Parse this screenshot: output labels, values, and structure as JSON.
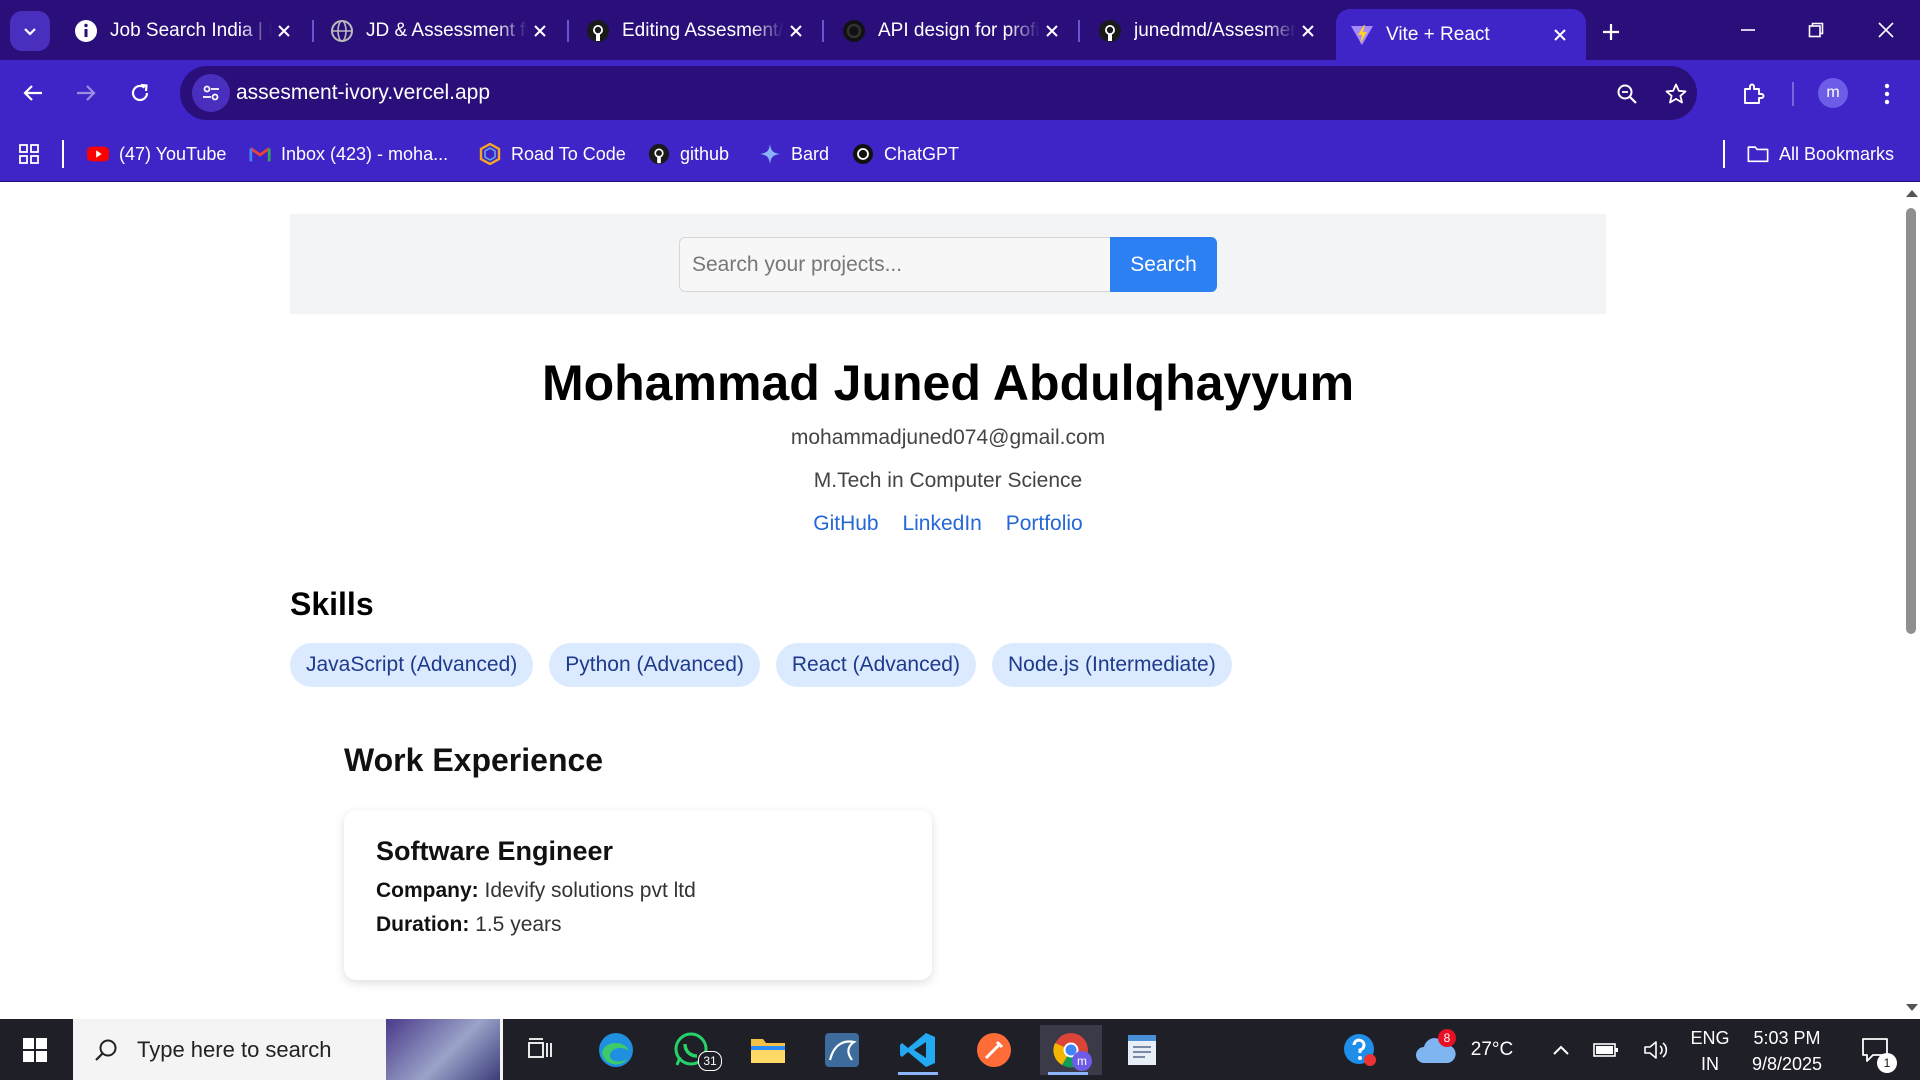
{
  "browser": {
    "tabs": [
      {
        "title": "Job Search India | Indeed",
        "icon": "info-icon"
      },
      {
        "title": "JD & Assessment for",
        "icon": "globe-icon"
      },
      {
        "title": "Editing Assesment/README",
        "icon": "github-icon"
      },
      {
        "title": "API design for profile",
        "icon": "openai-icon"
      },
      {
        "title": "junedmd/Assesment",
        "icon": "github-icon"
      },
      {
        "title": "Vite + React",
        "icon": "vite-icon",
        "active": true
      }
    ],
    "url": "assesment-ivory.vercel.app",
    "profile_initial": "m",
    "bookmarks": [
      {
        "label": "(47) YouTube",
        "icon": "youtube-icon"
      },
      {
        "label": "Inbox (423) - moha...",
        "icon": "gmail-icon"
      },
      {
        "label": "Road To Code",
        "icon": "road-to-code-icon"
      },
      {
        "label": "github",
        "icon": "github-icon"
      },
      {
        "label": "Bard",
        "icon": "bard-icon"
      },
      {
        "label": "ChatGPT",
        "icon": "chatgpt-icon"
      }
    ],
    "all_bookmarks_label": "All Bookmarks"
  },
  "page": {
    "search": {
      "placeholder": "Search your projects...",
      "button_label": "Search"
    },
    "profile": {
      "name": "Mohammad Juned Abdulqhayyum",
      "email": "mohammadjuned074@gmail.com",
      "education": "M.Tech in Computer Science",
      "links": [
        "GitHub",
        "LinkedIn",
        "Portfolio"
      ]
    },
    "skills_heading": "Skills",
    "skills": [
      "JavaScript (Advanced)",
      "Python (Advanced)",
      "React (Advanced)",
      "Node.js (Intermediate)"
    ],
    "work_heading": "Work Experience",
    "work": [
      {
        "title": "Software Engineer",
        "company_label": "Company:",
        "company": "Idevify solutions pvt ltd",
        "duration_label": "Duration:",
        "duration": "1.5 years"
      }
    ]
  },
  "taskbar": {
    "search_placeholder": "Type here to search",
    "whatsapp_badge": "31",
    "weather_badge": "8",
    "temperature": "27°C",
    "lang_top": "ENG",
    "lang_bottom": "IN",
    "time": "5:03 PM",
    "date": "9/8/2025",
    "notification_count": "1"
  },
  "colors": {
    "tab_bar": "#2a0f7a",
    "toolbar": "#3f24c8",
    "accent": "#2d80f2",
    "skill_bg": "#dbeafe",
    "link": "#2468d6"
  }
}
